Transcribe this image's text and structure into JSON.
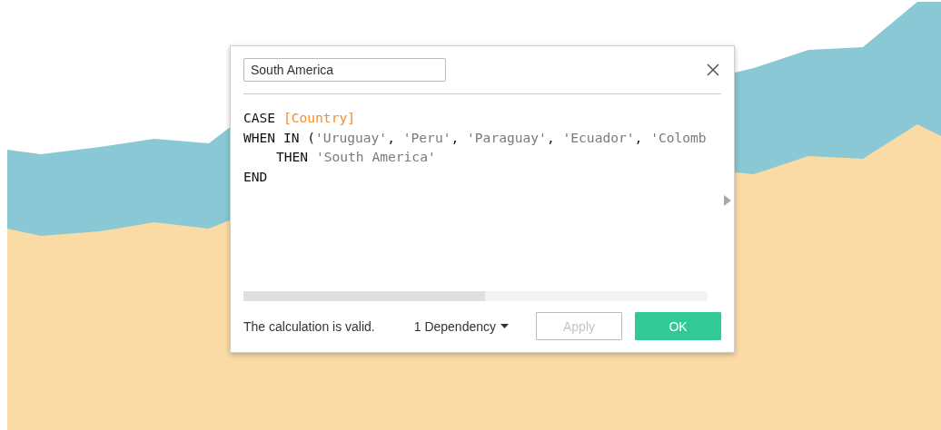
{
  "dialog": {
    "name_field": {
      "value": "South America"
    },
    "code_lines": [
      {
        "indented": false,
        "tokens": [
          {
            "kind": "keyword",
            "text": "CASE "
          },
          {
            "kind": "field",
            "text": "[Country]"
          }
        ]
      },
      {
        "indented": false,
        "tokens": [
          {
            "kind": "keyword",
            "text": "WHEN IN ("
          },
          {
            "kind": "string",
            "text": "'Uruguay'"
          },
          {
            "kind": "keyword",
            "text": ", "
          },
          {
            "kind": "string",
            "text": "'Peru'"
          },
          {
            "kind": "keyword",
            "text": ", "
          },
          {
            "kind": "string",
            "text": "'Paraguay'"
          },
          {
            "kind": "keyword",
            "text": ", "
          },
          {
            "kind": "string",
            "text": "'Ecuador'"
          },
          {
            "kind": "keyword",
            "text": ", "
          },
          {
            "kind": "string",
            "text": "'Colomb"
          }
        ]
      },
      {
        "indented": true,
        "tokens": [
          {
            "kind": "keyword",
            "text": "THEN "
          },
          {
            "kind": "string",
            "text": "'South America'"
          }
        ]
      },
      {
        "indented": false,
        "tokens": [
          {
            "kind": "keyword",
            "text": "END"
          }
        ]
      }
    ],
    "status": "The calculation is valid.",
    "dependency": "1 Dependency",
    "buttons": [
      {
        "label": "Apply",
        "disabled": true,
        "kind": "secondary"
      },
      {
        "label": "OK",
        "disabled": false,
        "kind": "primary"
      }
    ]
  }
}
